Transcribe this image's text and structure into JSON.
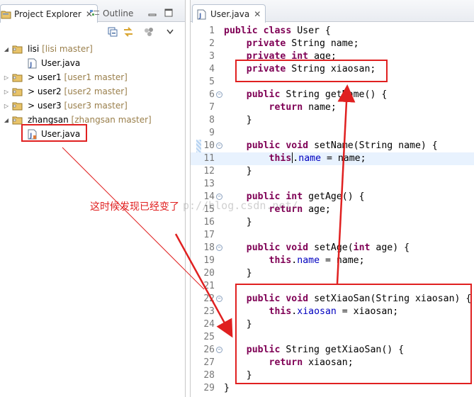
{
  "left_pane": {
    "tabs": [
      {
        "label": "Project Explorer",
        "icon": "project-explorer-icon",
        "close": "✕"
      },
      {
        "label": "Outline",
        "icon": "outline-icon"
      }
    ],
    "tree": [
      {
        "label": "lisi",
        "decoration": "[lisi master]",
        "icon": "git-project-folder-icon",
        "expanded": true
      },
      {
        "label": "User.java",
        "icon": "java-file-icon"
      },
      {
        "label": "> user1",
        "decoration": "[user1 master]",
        "icon": "git-project-folder-icon",
        "expanded": false
      },
      {
        "label": "> user2",
        "decoration": "[user2 master]",
        "icon": "git-project-folder-icon",
        "expanded": false
      },
      {
        "label": "> user3",
        "decoration": "[user3 master]",
        "icon": "git-project-folder-icon",
        "expanded": false
      },
      {
        "label": "zhangsan",
        "decoration": "[zhangsan master]",
        "icon": "git-project-folder-icon",
        "expanded": true
      },
      {
        "label": "User.java",
        "icon": "java-file-icon",
        "highlighted": true
      }
    ]
  },
  "editor": {
    "tab_label": "User.java",
    "tab_close": "✕",
    "lines": [
      {
        "n": "1",
        "tokens": [
          {
            "t": "public",
            "k": "kw"
          },
          {
            "t": " "
          },
          {
            "t": "class",
            "k": "kw"
          },
          {
            "t": " User {"
          }
        ]
      },
      {
        "n": "2",
        "tokens": [
          {
            "t": "    "
          },
          {
            "t": "private",
            "k": "kw"
          },
          {
            "t": " String name;"
          }
        ]
      },
      {
        "n": "3",
        "tokens": [
          {
            "t": "    "
          },
          {
            "t": "private",
            "k": "kw"
          },
          {
            "t": " "
          },
          {
            "t": "int",
            "k": "kw"
          },
          {
            "t": " age;"
          }
        ]
      },
      {
        "n": "4",
        "tokens": [
          {
            "t": "    "
          },
          {
            "t": "private",
            "k": "kw"
          },
          {
            "t": " String xiaosan;"
          }
        ]
      },
      {
        "n": "5",
        "tokens": []
      },
      {
        "n": "6",
        "fold": true,
        "tokens": [
          {
            "t": "    "
          },
          {
            "t": "public",
            "k": "kw"
          },
          {
            "t": " String getName() {"
          }
        ]
      },
      {
        "n": "7",
        "tokens": [
          {
            "t": "        "
          },
          {
            "t": "return",
            "k": "kw"
          },
          {
            "t": " name;"
          }
        ]
      },
      {
        "n": "8",
        "tokens": [
          {
            "t": "    }"
          }
        ]
      },
      {
        "n": "9",
        "tokens": []
      },
      {
        "n": "10",
        "fold": true,
        "tokens": [
          {
            "t": "    "
          },
          {
            "t": "public",
            "k": "kw"
          },
          {
            "t": " "
          },
          {
            "t": "void",
            "k": "kw"
          },
          {
            "t": " setName(String name) {"
          }
        ]
      },
      {
        "n": "11",
        "current": true,
        "tokens": [
          {
            "t": "        "
          },
          {
            "t": "this",
            "k": "kw"
          },
          {
            "t": "",
            "caret": true
          },
          {
            "t": "."
          },
          {
            "t": "name",
            "k": "fld"
          },
          {
            "t": " = name;"
          }
        ]
      },
      {
        "n": "12",
        "tokens": [
          {
            "t": "    }"
          }
        ]
      },
      {
        "n": "13",
        "tokens": []
      },
      {
        "n": "14",
        "fold": true,
        "tokens": [
          {
            "t": "    "
          },
          {
            "t": "public",
            "k": "kw"
          },
          {
            "t": " "
          },
          {
            "t": "int",
            "k": "kw"
          },
          {
            "t": " getAge() {"
          }
        ]
      },
      {
        "n": "15",
        "tokens": [
          {
            "t": "        "
          },
          {
            "t": "return",
            "k": "kw"
          },
          {
            "t": " age;"
          }
        ]
      },
      {
        "n": "16",
        "tokens": [
          {
            "t": "    }"
          }
        ]
      },
      {
        "n": "17",
        "tokens": []
      },
      {
        "n": "18",
        "fold": true,
        "tokens": [
          {
            "t": "    "
          },
          {
            "t": "public",
            "k": "kw"
          },
          {
            "t": " "
          },
          {
            "t": "void",
            "k": "kw"
          },
          {
            "t": " setAge("
          },
          {
            "t": "int",
            "k": "kw"
          },
          {
            "t": " age) {"
          }
        ]
      },
      {
        "n": "19",
        "tokens": [
          {
            "t": "        "
          },
          {
            "t": "this",
            "k": "kw"
          },
          {
            "t": "."
          },
          {
            "t": "name",
            "k": "fld"
          },
          {
            "t": " = name;"
          }
        ]
      },
      {
        "n": "20",
        "tokens": [
          {
            "t": "    }"
          }
        ]
      },
      {
        "n": "21",
        "tokens": []
      },
      {
        "n": "22",
        "fold": true,
        "tokens": [
          {
            "t": "    "
          },
          {
            "t": "public",
            "k": "kw"
          },
          {
            "t": " "
          },
          {
            "t": "void",
            "k": "kw"
          },
          {
            "t": " setXiaoSan(String xiaosan) {"
          }
        ]
      },
      {
        "n": "23",
        "tokens": [
          {
            "t": "        "
          },
          {
            "t": "this",
            "k": "kw"
          },
          {
            "t": "."
          },
          {
            "t": "xiaosan",
            "k": "fld"
          },
          {
            "t": " = xiaosan;"
          }
        ]
      },
      {
        "n": "24",
        "tokens": [
          {
            "t": "    }"
          }
        ]
      },
      {
        "n": "25",
        "tokens": []
      },
      {
        "n": "26",
        "fold": true,
        "tokens": [
          {
            "t": "    "
          },
          {
            "t": "public",
            "k": "kw"
          },
          {
            "t": " String getXiaoSan() {"
          }
        ]
      },
      {
        "n": "27",
        "tokens": [
          {
            "t": "        "
          },
          {
            "t": "return",
            "k": "kw"
          },
          {
            "t": " xiaosan;"
          }
        ]
      },
      {
        "n": "28",
        "tokens": [
          {
            "t": "    }"
          }
        ]
      },
      {
        "n": "29",
        "tokens": [
          {
            "t": "}"
          }
        ]
      }
    ]
  },
  "annotation": {
    "text": "这时候发现已经变了",
    "color": "#e02020"
  },
  "watermark": {
    "text": "p://blog.csdn.net/"
  },
  "colors": {
    "keyword": "#7f0055",
    "field": "#0000c0",
    "decoration": "#9a7f4b",
    "line_number": "#787878",
    "annotation_red": "#e02020"
  }
}
